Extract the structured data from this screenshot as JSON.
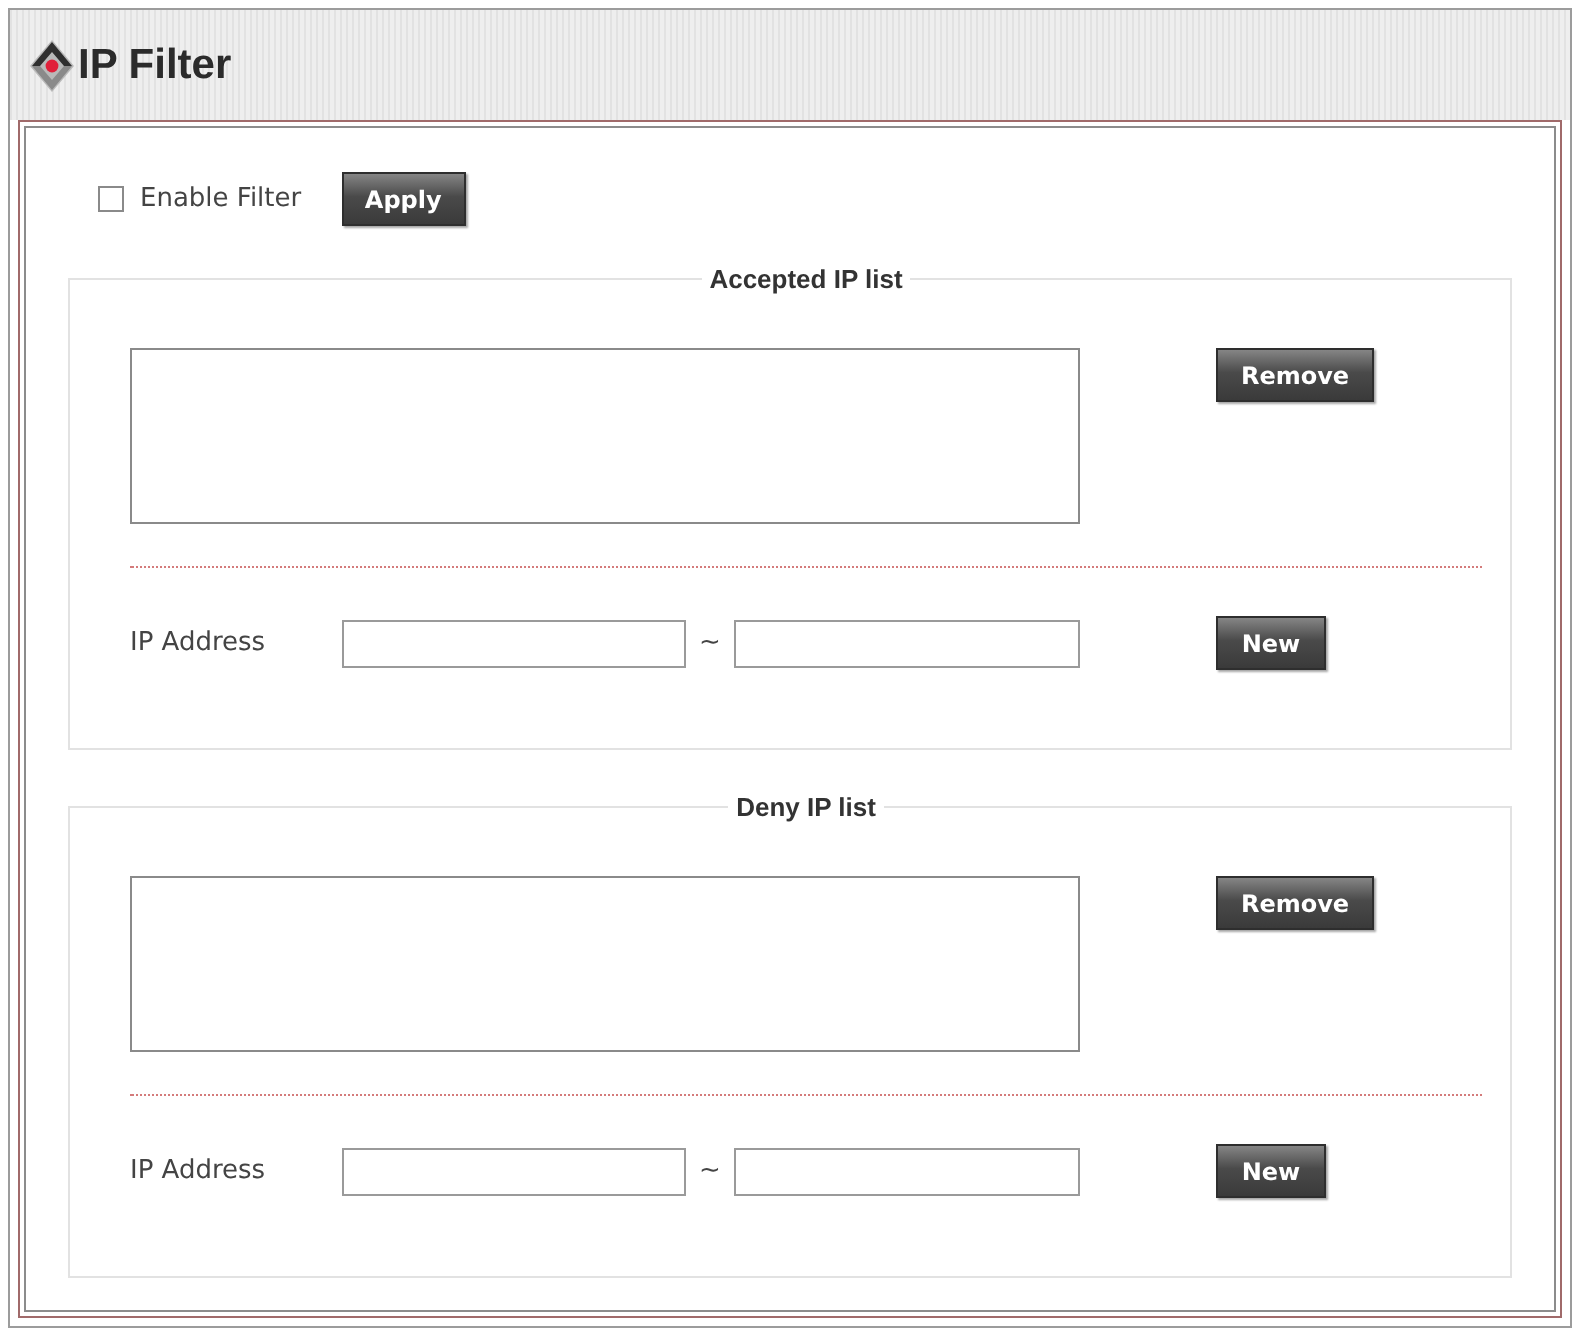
{
  "window": {
    "title": "IP Filter"
  },
  "enable_filter": {
    "label": "Enable Filter",
    "checked": false
  },
  "apply_button": {
    "label": "Apply"
  },
  "ip_lists": [
    {
      "legend": "Accepted IP list",
      "remove_button": "Remove",
      "address_label": "IP Address",
      "range_separator": "~",
      "new_button": "New"
    },
    {
      "legend": "Deny IP list",
      "remove_button": "Remove",
      "address_label": "IP Address",
      "range_separator": "~",
      "new_button": "New"
    }
  ]
}
